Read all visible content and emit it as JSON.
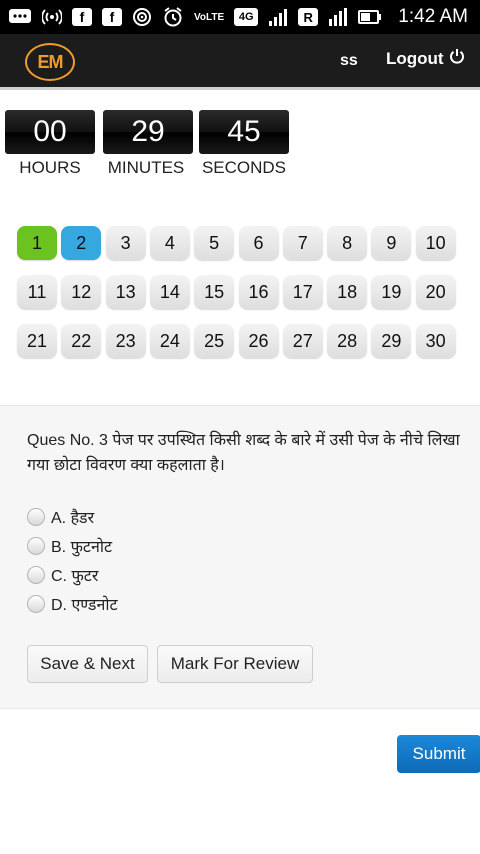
{
  "status_bar": {
    "icons": [
      "chat-icon",
      "hotspot-icon",
      "facebook-icon",
      "facebook-icon",
      "wifi-icon",
      "alarm-icon",
      "volte-icon",
      "4g-icon",
      "signal-icon",
      "roaming-icon",
      "signal-2-icon",
      "battery-icon"
    ],
    "volte_text": "VoLTE",
    "net_text": "4G",
    "time": "1:42 AM"
  },
  "header": {
    "logo_text": "EM",
    "username": "ss",
    "logout_label": "Logout"
  },
  "timer": {
    "hours": "00",
    "minutes": "29",
    "seconds": "45",
    "hours_label": "HOURS",
    "minutes_label": "MINUTES",
    "seconds_label": "SECONDS"
  },
  "palette": {
    "questions": [
      "1",
      "2",
      "3",
      "4",
      "5",
      "6",
      "7",
      "8",
      "9",
      "10",
      "11",
      "12",
      "13",
      "14",
      "15",
      "16",
      "17",
      "18",
      "19",
      "20",
      "21",
      "22",
      "23",
      "24",
      "25",
      "26",
      "27",
      "28",
      "29",
      "30"
    ],
    "answered": [
      "1"
    ],
    "current": "2",
    "colors": {
      "answered": "#6cc320",
      "current": "#36a8e0"
    }
  },
  "question": {
    "text": "Ques No. 3 पेज पर उपस्थित किसी शब्द के बारे में उसी पेज के नीचे लिखा गया छोटा विवरण क्या कहलाता है।",
    "options": [
      "A. हैडर",
      "B. फुटनोट",
      "C. फुटर",
      "D. एण्डनोट"
    ]
  },
  "buttons": {
    "save_next": "Save & Next",
    "mark_review": "Mark For Review",
    "submit": "Submit"
  }
}
